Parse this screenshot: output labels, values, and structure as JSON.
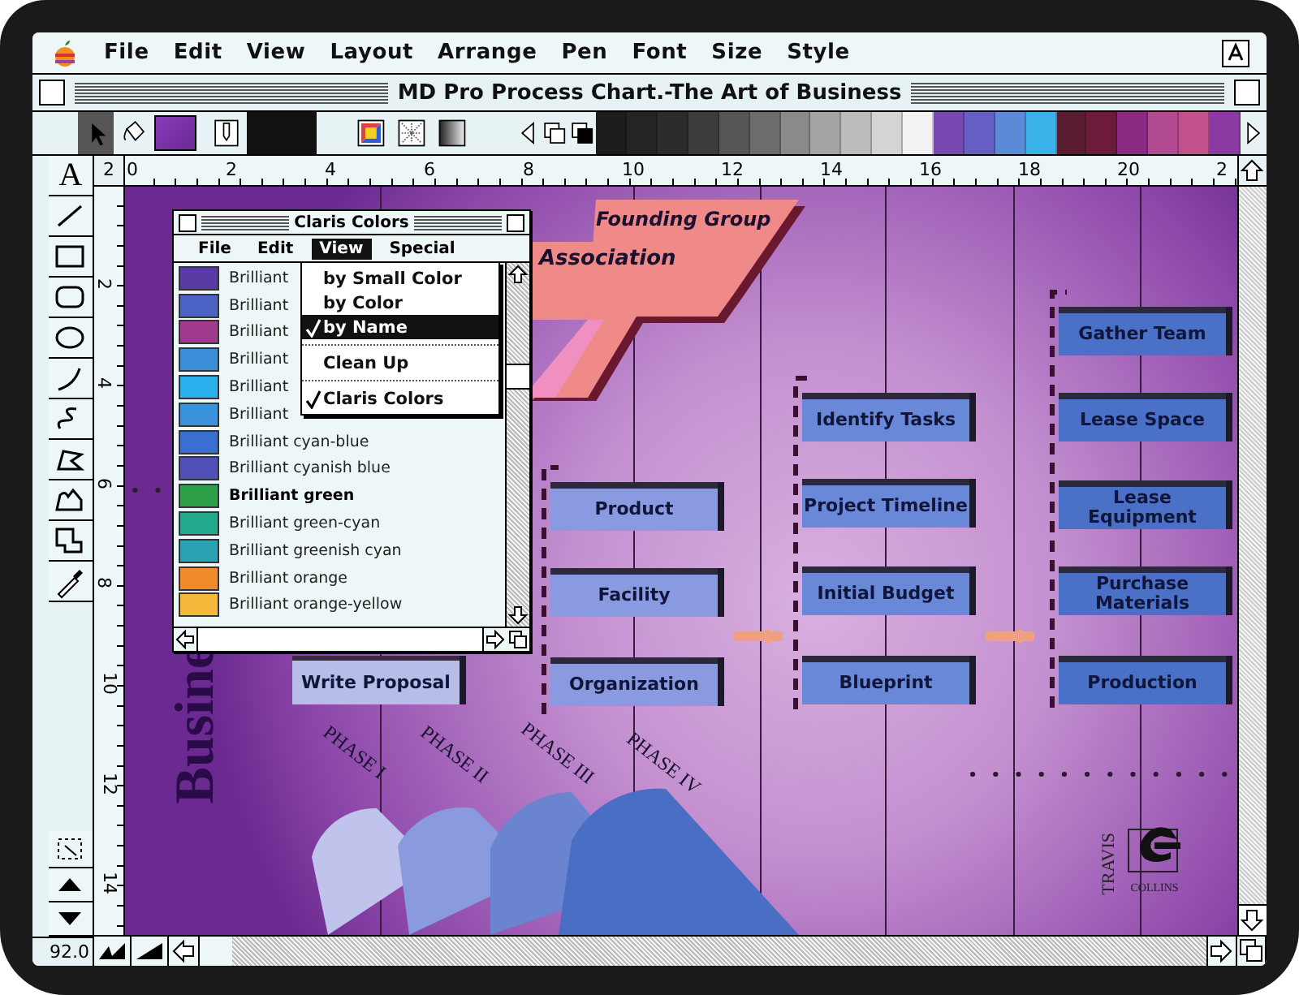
{
  "menu_bar": {
    "items": [
      "File",
      "Edit",
      "View",
      "Layout",
      "Arrange",
      "Pen",
      "Font",
      "Size",
      "Style"
    ]
  },
  "window": {
    "title": "MD Pro Process Chart.-The Art of Business"
  },
  "palette": {
    "swatches": [
      {
        "color": "#1c1c1c"
      },
      {
        "color": "#242424"
      },
      {
        "color": "#2c2c2c"
      },
      {
        "color": "#3c3c3c"
      },
      {
        "color": "#555555"
      },
      {
        "color": "#6c6c6c"
      },
      {
        "color": "#8a8a8a"
      },
      {
        "color": "#a4a4a4"
      },
      {
        "color": "#bcbcbc"
      },
      {
        "color": "#d4d4d4"
      },
      {
        "color": "#f2f2f2"
      },
      {
        "color": "#7648b0"
      },
      {
        "color": "#6660c4"
      },
      {
        "color": "#5a8ad8"
      },
      {
        "color": "#3cb2ea"
      },
      {
        "color": "#5a1c30"
      },
      {
        "color": "#6c1c3a"
      },
      {
        "color": "#8a2a82"
      },
      {
        "color": "#b24a92"
      },
      {
        "color": "#c2508c"
      },
      {
        "color": "#8a3aa2"
      }
    ]
  },
  "rulers": {
    "corner": "2",
    "horizontal": [
      "0",
      "2",
      "4",
      "6",
      "8",
      "10",
      "12",
      "14",
      "16",
      "18",
      "20",
      "2"
    ],
    "vertical": [
      "2",
      "4",
      "6",
      "8",
      "10",
      "12",
      "14"
    ]
  },
  "zoom": "92.0",
  "toolbox": {
    "text_tool": "A"
  },
  "claris_colors": {
    "title": "Claris Colors",
    "menus": [
      {
        "label": "File",
        "selected": false
      },
      {
        "label": "Edit",
        "selected": false
      },
      {
        "label": "View",
        "selected": true
      },
      {
        "label": "Special",
        "selected": false
      }
    ],
    "colors": [
      {
        "name": "Brilliant",
        "color": "#5a3aa4",
        "selected": false
      },
      {
        "name": "Brilliant",
        "color": "#4a62c4",
        "selected": false
      },
      {
        "name": "Brilliant",
        "color": "#a03a8c",
        "selected": false
      },
      {
        "name": "Brilliant",
        "color": "#3a8ed8",
        "selected": false
      },
      {
        "name": "Brilliant",
        "color": "#2ab0ec",
        "selected": false
      },
      {
        "name": "Brilliant",
        "color": "#3a92dc",
        "selected": false
      },
      {
        "name": "Brilliant cyan-blue",
        "color": "#3a6ed0",
        "selected": false
      },
      {
        "name": "Brilliant cyanish blue",
        "color": "#5050b8",
        "selected": false
      },
      {
        "name": "Brilliant green",
        "color": "#2ea04a",
        "selected": true
      },
      {
        "name": "Brilliant green-cyan",
        "color": "#22a88a",
        "selected": false
      },
      {
        "name": "Brilliant greenish cyan",
        "color": "#2aa2b4",
        "selected": false
      },
      {
        "name": "Brilliant orange",
        "color": "#f08a2a",
        "selected": false
      },
      {
        "name": "Brilliant orange-yellow",
        "color": "#f4b83a",
        "selected": false
      }
    ],
    "view_menu": [
      {
        "kind": "item",
        "label": "by Small Color",
        "checked": false,
        "selected": false
      },
      {
        "kind": "item",
        "label": "by Color",
        "checked": false,
        "selected": false
      },
      {
        "kind": "item",
        "label": "by Name",
        "checked": true,
        "selected": true
      },
      {
        "kind": "separator"
      },
      {
        "kind": "item",
        "label": "Clean Up",
        "checked": false,
        "selected": false
      },
      {
        "kind": "separator"
      },
      {
        "kind": "item",
        "label": "Claris Colors",
        "checked": true,
        "selected": false
      }
    ]
  },
  "chart": {
    "heading": "Founding Group",
    "subheading": "Association",
    "side_title": "Busine",
    "tasks": [
      {
        "label": "Write Proposal",
        "color": "#b8bce8"
      },
      {
        "label": "Product",
        "color": "#8a9ae0"
      },
      {
        "label": "Facility",
        "color": "#8a9ae0"
      },
      {
        "label": "Organization",
        "color": "#8a9ae0"
      },
      {
        "label": "Identify Tasks",
        "color": "#6a88d8"
      },
      {
        "label": "Project Timeline",
        "color": "#6a88d8"
      },
      {
        "label": "Initial Budget",
        "color": "#6a88d8"
      },
      {
        "label": "Blueprint",
        "color": "#6a88d8"
      },
      {
        "label": "Gather Team",
        "color": "#4a70c8"
      },
      {
        "label": "Lease Space",
        "color": "#4a70c8"
      },
      {
        "label": "Lease\nEquipment",
        "color": "#4a70c8"
      },
      {
        "label": "Purchase\nMaterials",
        "color": "#4a70c8"
      },
      {
        "label": "Production",
        "color": "#4a70c8"
      }
    ],
    "phases": [
      "PHASE I",
      "PHASE II",
      "PHASE III",
      "PHASE IV"
    ],
    "logo": {
      "name": "TRAVIS",
      "caption": "COLLINS"
    }
  }
}
